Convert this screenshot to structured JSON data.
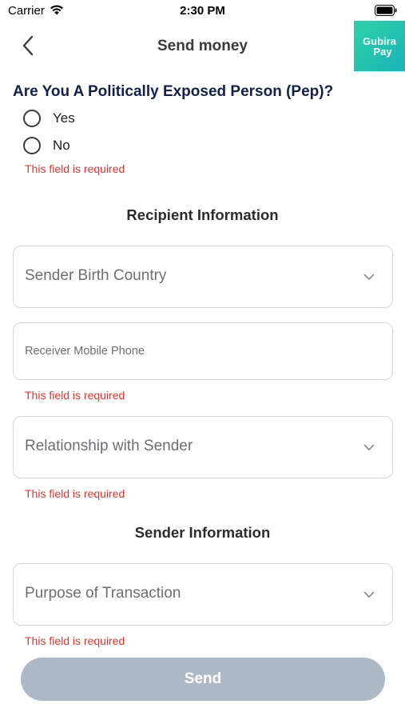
{
  "status_bar": {
    "carrier": "Carrier",
    "time": "2:30 PM"
  },
  "nav": {
    "title": "Send money",
    "logo_line1": "Gubira",
    "logo_line2": "Pay"
  },
  "pep": {
    "question": "Are You A Politically Exposed Person (Pep)?",
    "options": [
      {
        "label": "Yes",
        "selected": false
      },
      {
        "label": "No",
        "selected": false
      }
    ],
    "error": "This field is required"
  },
  "recipient_section": {
    "heading": "Recipient Information",
    "birth_country_label": "Sender Birth Country",
    "mobile_phone_placeholder": "Receiver Mobile Phone",
    "mobile_phone_error": "This field is required",
    "relationship_label": "Relationship with Sender",
    "relationship_error": "This field is required"
  },
  "sender_section": {
    "heading": "Sender Information",
    "purpose_label": "Purpose of Transaction",
    "purpose_error": "This field is required"
  },
  "actions": {
    "send_label": "Send"
  },
  "colors": {
    "error": "#e8322c",
    "question": "#13214a",
    "send_disabled": "#aeb9c6",
    "logo_gradient_start": "#2ed3a5",
    "logo_gradient_end": "#19b3b8"
  }
}
